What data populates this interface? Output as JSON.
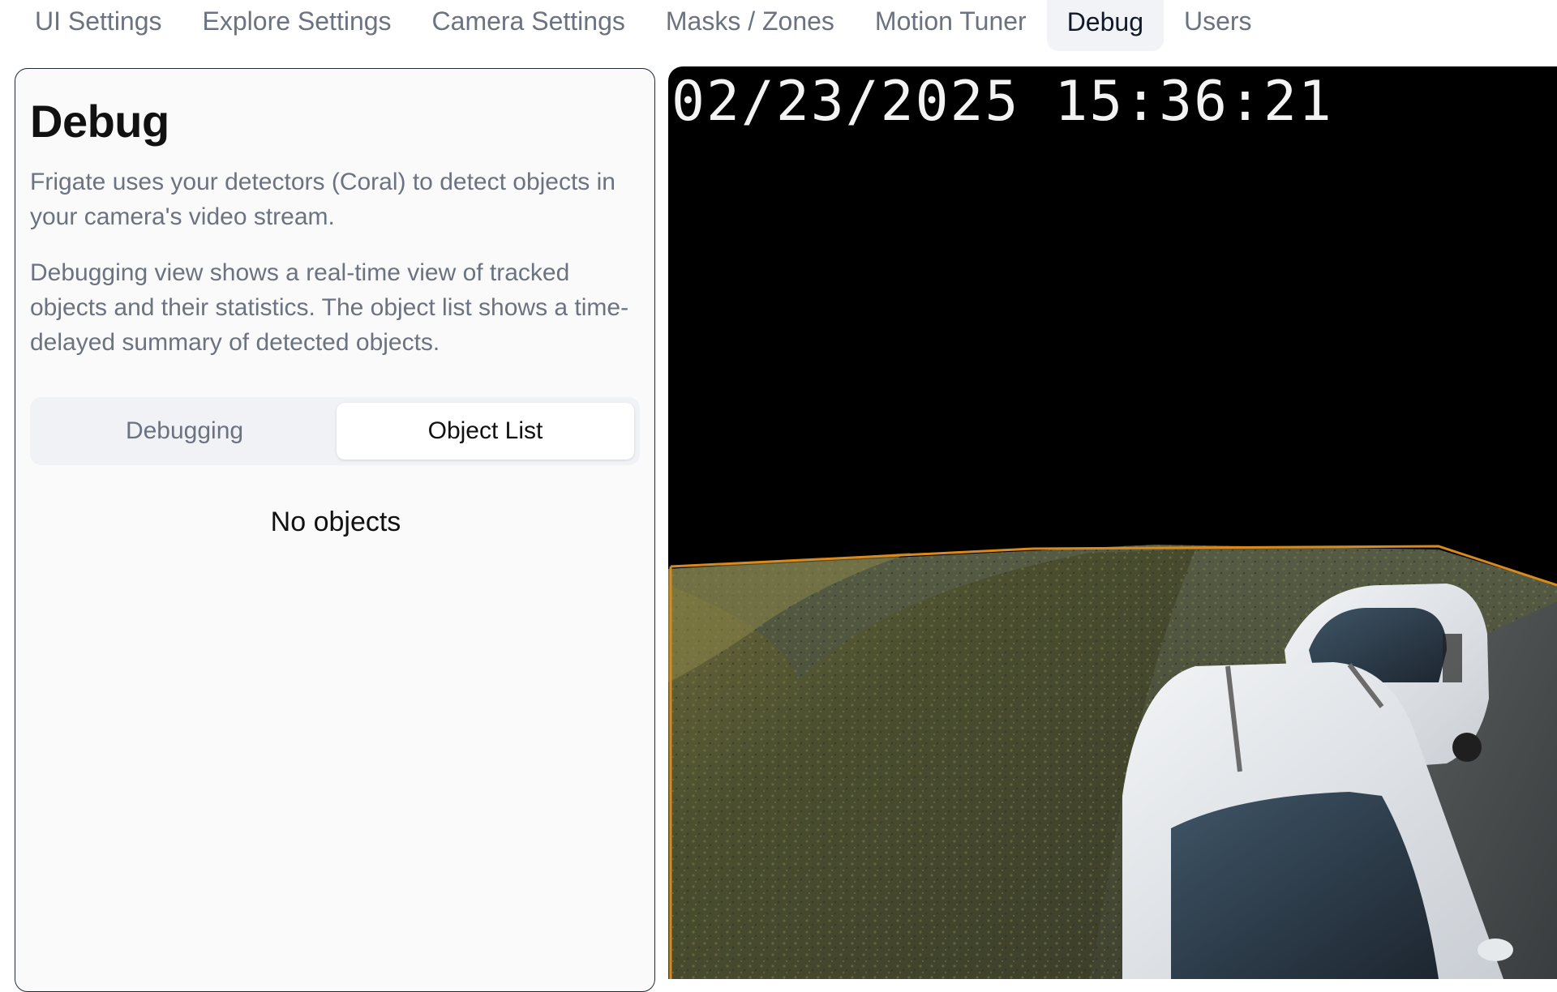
{
  "tabs": [
    {
      "label": "UI Settings",
      "active": false
    },
    {
      "label": "Explore Settings",
      "active": false
    },
    {
      "label": "Camera Settings",
      "active": false
    },
    {
      "label": "Masks / Zones",
      "active": false
    },
    {
      "label": "Motion Tuner",
      "active": false
    },
    {
      "label": "Debug",
      "active": true
    },
    {
      "label": "Users",
      "active": false
    }
  ],
  "panel": {
    "title": "Debug",
    "description_1": "Frigate uses your detectors (Coral) to detect objects in your camera's video stream.",
    "description_2": "Debugging view shows a real-time view of tracked objects and their statistics. The object list shows a time-delayed summary of detected objects.",
    "segments": {
      "debugging": "Debugging",
      "object_list": "Object List",
      "selected": "object_list"
    },
    "empty_state": "No objects"
  },
  "camera": {
    "timestamp": "02/23/2025 15:36:21",
    "zone_color": "#d98a1e"
  }
}
